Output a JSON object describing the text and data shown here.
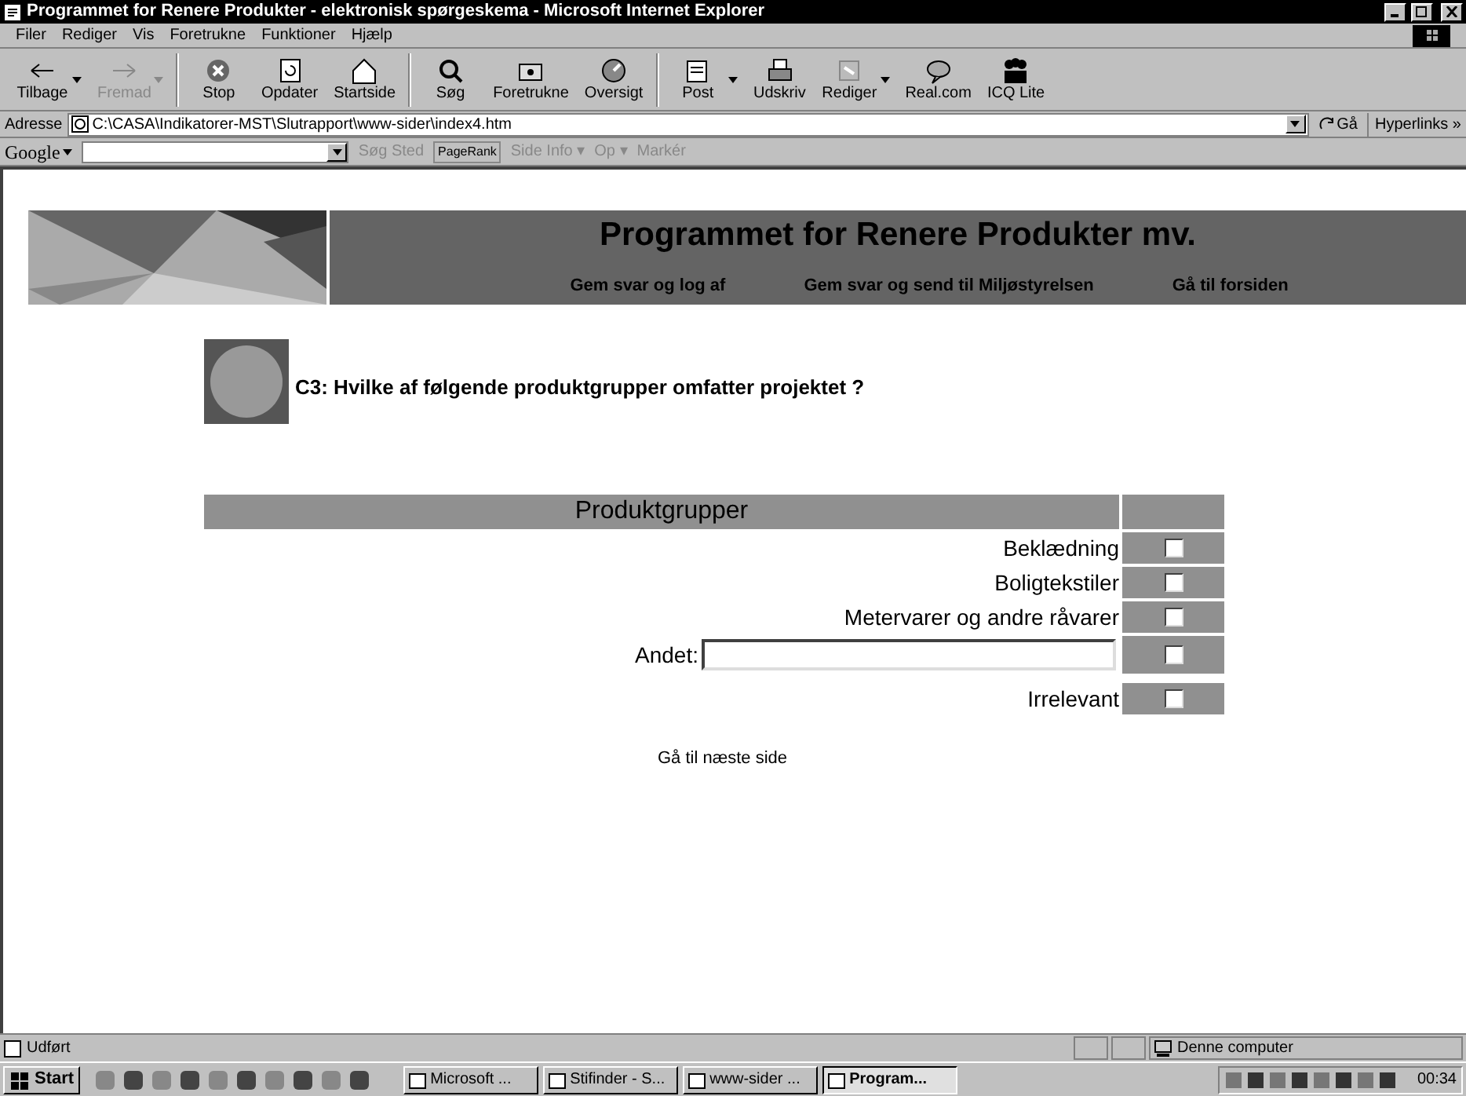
{
  "window": {
    "title": "Programmet for Renere Produkter - elektronisk spørgeskema - Microsoft Internet Explorer"
  },
  "menu": [
    "Filer",
    "Rediger",
    "Vis",
    "Foretrukne",
    "Funktioner",
    "Hjælp"
  ],
  "toolbar": [
    {
      "label": "Tilbage",
      "disabled": false,
      "dropdown": true
    },
    {
      "label": "Fremad",
      "disabled": true,
      "dropdown": true
    },
    {
      "label": "Stop",
      "disabled": false,
      "dropdown": false
    },
    {
      "label": "Opdater",
      "disabled": false,
      "dropdown": false
    },
    {
      "label": "Startside",
      "disabled": false,
      "dropdown": false
    },
    {
      "label": "Søg",
      "disabled": false,
      "dropdown": false
    },
    {
      "label": "Foretrukne",
      "disabled": false,
      "dropdown": false
    },
    {
      "label": "Oversigt",
      "disabled": false,
      "dropdown": false
    },
    {
      "label": "Post",
      "disabled": false,
      "dropdown": true
    },
    {
      "label": "Udskriv",
      "disabled": false,
      "dropdown": false
    },
    {
      "label": "Rediger",
      "disabled": false,
      "dropdown": true
    },
    {
      "label": "Real.com",
      "disabled": false,
      "dropdown": false
    },
    {
      "label": "ICQ Lite",
      "disabled": false,
      "dropdown": false
    }
  ],
  "address_bar": {
    "label": "Adresse",
    "value": "C:\\CASA\\Indikatorer-MST\\Slutrapport\\www-sider\\index4.htm",
    "go": "Gå",
    "links": "Hyperlinks »"
  },
  "google_toolbar": {
    "logo": "Google",
    "items": [
      "Søg Sted",
      "PageRank",
      "Side Info ▾",
      "Op ▾",
      "Markér"
    ]
  },
  "page": {
    "title": "Programmet for Renere Produkter mv.",
    "nav": [
      "Gem svar og log af",
      "Gem svar og send til Miljøstyrelsen",
      "Gå til forsiden"
    ],
    "question": "C3: Hvilke af følgende produktgrupper omfatter projektet ?",
    "table_header": "Produktgrupper",
    "rows": [
      {
        "kind": "checkbox",
        "label": "Beklædning",
        "checked": false
      },
      {
        "kind": "checkbox",
        "label": "Boligtekstiler",
        "checked": false
      },
      {
        "kind": "checkbox",
        "label": "Metervarer og andre råvarer",
        "checked": false
      },
      {
        "kind": "text",
        "label": "Andet:",
        "checked": false
      },
      {
        "kind": "checkbox",
        "label": "Irrelevant",
        "checked": false
      }
    ],
    "next": "Gå til næste side"
  },
  "status_bar": {
    "text": "Udført",
    "zone": "Denne computer"
  },
  "taskbar": {
    "start": "Start",
    "tasks": [
      {
        "label": "Microsoft ...",
        "selected": false
      },
      {
        "label": "Stifinder - S...",
        "selected": false
      },
      {
        "label": "www-sider ...",
        "selected": false
      },
      {
        "label": "Program...",
        "selected": true
      }
    ],
    "clock": "00:34"
  }
}
